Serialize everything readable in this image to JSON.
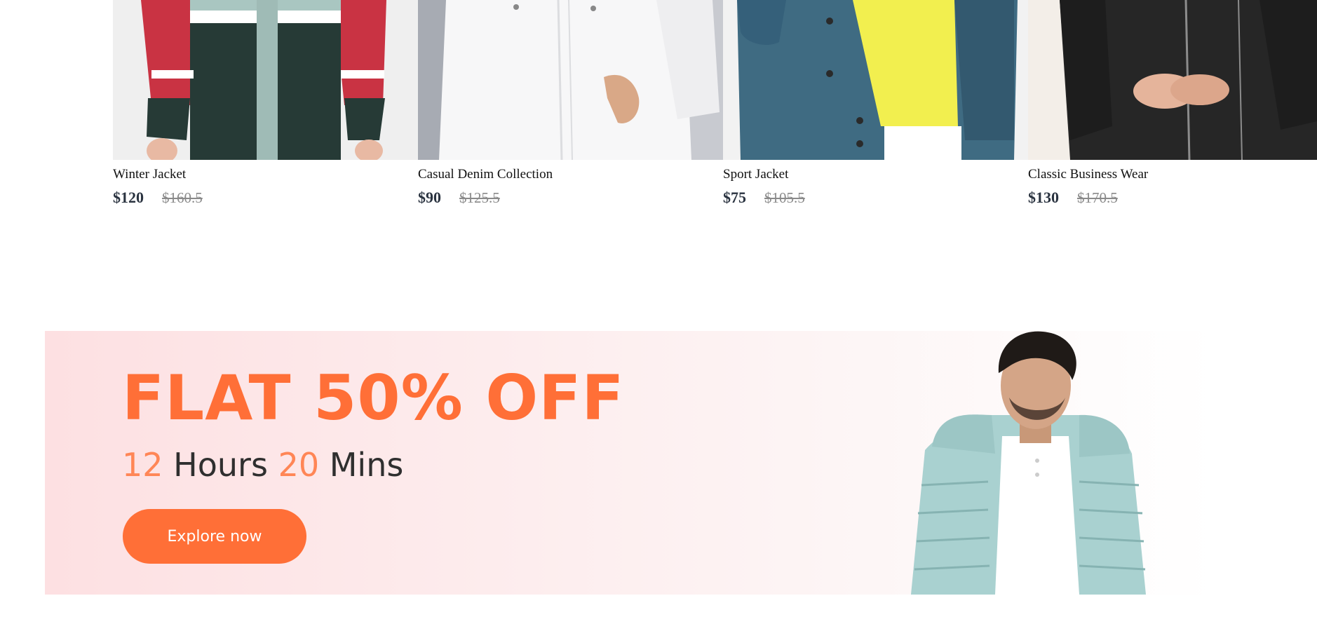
{
  "products": [
    {
      "name": "Winter Jacket",
      "price": "$120",
      "old_price": "$160.5",
      "image": "winter-jacket-photo"
    },
    {
      "name": "Casual Denim Collection",
      "price": "$90",
      "old_price": "$125.5",
      "image": "white-jacket-photo"
    },
    {
      "name": "Sport Jacket",
      "price": "$75",
      "old_price": "$105.5",
      "image": "denim-jacket-photo"
    },
    {
      "name": "Classic Business Wear",
      "price": "$130",
      "old_price": "$170.5",
      "image": "leather-jacket-photo"
    }
  ],
  "banner": {
    "headline": "FLAT 50% OFF",
    "hours_value": "12",
    "hours_label": "Hours",
    "mins_value": "20",
    "mins_label": "Mins",
    "cta_label": "Explore now",
    "image": "model-puffer-jacket-photo"
  },
  "colors": {
    "accent": "#ff6f37",
    "accent_light": "#ff8656",
    "price_text": "#2a3340",
    "old_price_text": "#8a8a8a",
    "banner_bg": "#fde0e2"
  }
}
